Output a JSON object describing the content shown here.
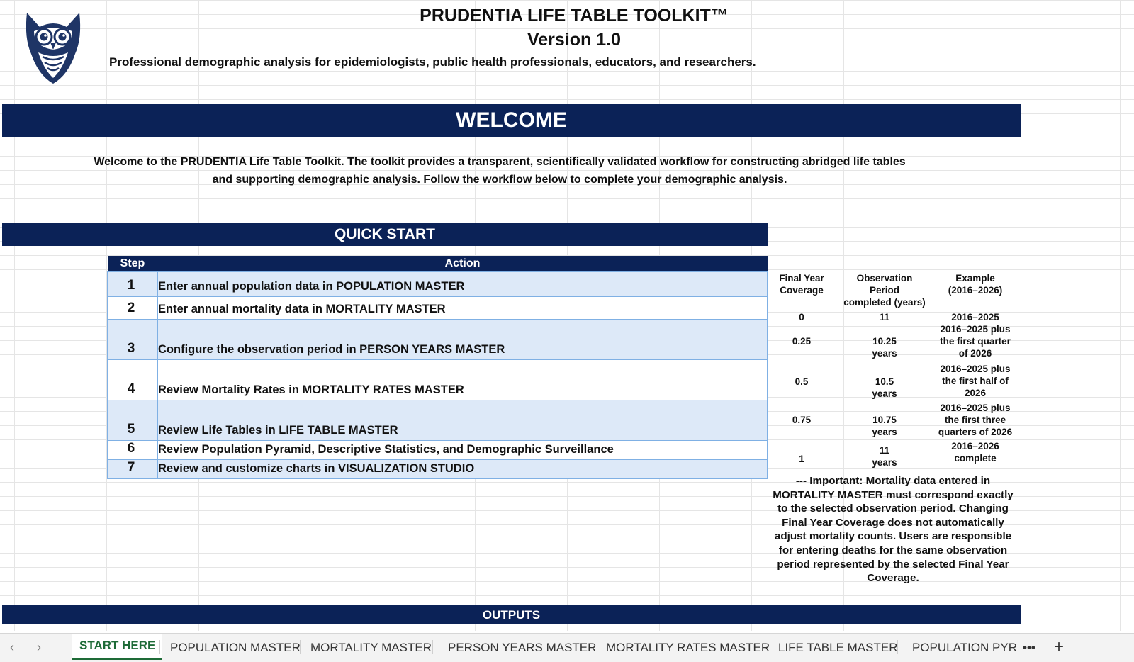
{
  "header": {
    "title": "PRUDENTIA LIFE TABLE TOOLKIT™",
    "version": "Version 1.0",
    "tagline": "Professional demographic analysis for epidemiologists, public health professionals, educators, and researchers."
  },
  "welcome": {
    "heading": "WELCOME",
    "text_line1": "Welcome to the PRUDENTIA Life Table Toolkit. The toolkit provides a transparent, scientifically validated workflow for constructing abridged life tables",
    "text_line2": "and supporting demographic analysis. Follow the workflow below to complete your demographic analysis."
  },
  "quick_start": {
    "heading": "QUICK START",
    "col_step": "Step",
    "col_action": "Action",
    "steps": [
      {
        "num": "1",
        "action": "Enter annual population data in POPULATION MASTER"
      },
      {
        "num": "2",
        "action": "Enter annual mortality data in MORTALITY MASTER"
      },
      {
        "num": "3",
        "action": "Configure the observation period in PERSON YEARS MASTER"
      },
      {
        "num": "4",
        "action": "Review Mortality Rates in MORTALITY RATES MASTER"
      },
      {
        "num": "5",
        "action": "Review Life Tables in LIFE TABLE MASTER"
      },
      {
        "num": "6",
        "action": "Review Population Pyramid, Descriptive Statistics, and Demographic Surveillance"
      },
      {
        "num": "7",
        "action": "Review and customize charts in VISUALIZATION STUDIO"
      }
    ]
  },
  "coverage": {
    "headers": {
      "final_year": [
        "Final Year",
        "Coverage"
      ],
      "observation": [
        "Observation",
        "Period",
        "completed (years)"
      ],
      "example": [
        "Example",
        "(2016–2026)"
      ]
    },
    "rows": [
      {
        "coverage": "0",
        "period": [
          "11"
        ],
        "example": [
          "2016–2025"
        ]
      },
      {
        "coverage": "0.25",
        "period": [
          "10.25",
          "years"
        ],
        "example": [
          "2016–2025 plus",
          "the first quarter",
          "of 2026"
        ]
      },
      {
        "coverage": "0.5",
        "period": [
          "10.5",
          "years"
        ],
        "example": [
          "2016–2025 plus",
          "the first half of",
          "2026"
        ]
      },
      {
        "coverage": "0.75",
        "period": [
          "10.75",
          "years"
        ],
        "example": [
          "2016–2025 plus",
          "the first three",
          "quarters of 2026"
        ]
      },
      {
        "coverage": "1",
        "period": [
          "11",
          "years"
        ],
        "example": [
          "2016–2026",
          "complete"
        ]
      }
    ],
    "important": [
      "--- Important: Mortality data entered in",
      "MORTALITY MASTER must correspond exactly",
      "to the selected observation period. Changing",
      "Final Year Coverage does not automatically",
      "adjust mortality counts. Users are responsible",
      "for entering deaths for the same observation",
      "period represented by the selected Final Year",
      "Coverage."
    ]
  },
  "outputs": {
    "heading": "OUTPUTS"
  },
  "tabs": {
    "prev_icon": "chevron-left-icon",
    "next_icon": "chevron-right-icon",
    "items": [
      "START HERE",
      "POPULATION MASTER",
      "MORTALITY MASTER",
      "PERSON YEARS MASTER",
      "MORTALITY RATES MASTER",
      "LIFE TABLE MASTER",
      "POPULATION PYR"
    ],
    "more": "•••",
    "add": "+"
  },
  "colors": {
    "navy": "#0b2257",
    "row_blue": "#dde9f8",
    "active_tab": "#1e6b37"
  }
}
